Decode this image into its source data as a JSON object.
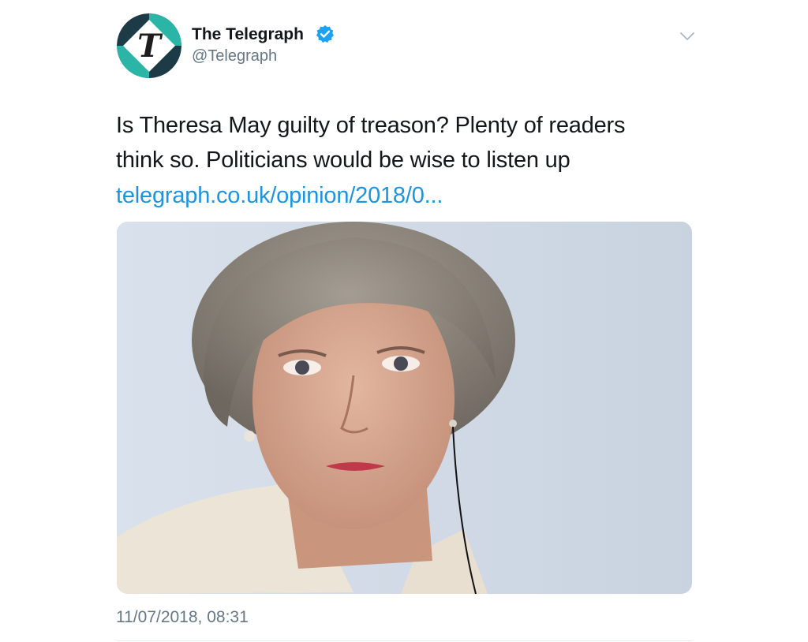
{
  "tweet": {
    "author": {
      "display_name": "The Telegraph",
      "handle": "@Telegraph",
      "verified": true,
      "avatar_icon": "telegraph-logo-icon",
      "avatar_colors": {
        "ring_dark": "#1d3b47",
        "ring_teal": "#2bb5a6",
        "letter": "#1d1d1d"
      },
      "verified_color": "#1da1f2"
    },
    "menu_icon": "chevron-down-icon",
    "text_lines": [
      "Is Theresa May guilty of treason? Plenty of readers",
      "think so. Politicians would be wise to listen up"
    ],
    "link_text": "telegraph.co.uk/opinion/2018/0...",
    "link_color": "#1b95e0",
    "timestamp": "11/07/2018, 08:31"
  }
}
